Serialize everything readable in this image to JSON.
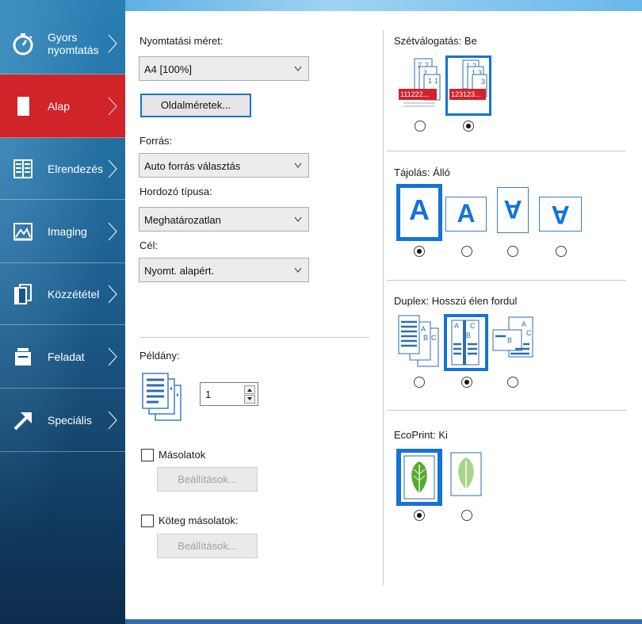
{
  "sidebar": {
    "items": [
      {
        "label_line1": "Gyors",
        "label_line2": "nyomtatás",
        "icon": "stopwatch-icon",
        "active": false
      },
      {
        "label_line1": "Alap",
        "label_line2": "",
        "icon": "page-icon",
        "active": true
      },
      {
        "label_line1": "Elrendezés",
        "label_line2": "",
        "icon": "layout-icon",
        "active": false
      },
      {
        "label_line1": "Imaging",
        "label_line2": "",
        "icon": "image-icon",
        "active": false
      },
      {
        "label_line1": "Közzététel",
        "label_line2": "",
        "icon": "publish-icon",
        "active": false
      },
      {
        "label_line1": "Feladat",
        "label_line2": "",
        "icon": "job-icon",
        "active": false
      },
      {
        "label_line1": "Speciális",
        "label_line2": "",
        "icon": "arrow-icon",
        "active": false
      }
    ],
    "colors": {
      "active": "#d0232a",
      "base": "#1d5f8f"
    }
  },
  "left": {
    "print_size_label": "Nyomtatási méret:",
    "print_size_value": "A4 [100%]",
    "page_sizes_button": "Oldalméretek...",
    "source_label": "Forrás:",
    "source_value": "Auto forrás választás",
    "media_label": "Hordozó típusa:",
    "media_value": "Meghatározatlan",
    "dest_label": "Cél:",
    "dest_value": "Nyomt. alapért.",
    "copies_label": "Példány:",
    "copies_value": "1",
    "copies_checkbox": "Másolatok",
    "copies_settings": "Beállítások...",
    "batch_checkbox": "Köteg másolatok:",
    "batch_settings": "Beállítások..."
  },
  "right": {
    "collate_label": "Szétválogatás:",
    "collate_value": "Be",
    "collate_off_text": "111222...",
    "collate_on_text": "123123...",
    "orientation_label": "Tájolás:",
    "orientation_value": "Álló",
    "orientation_letter": "A",
    "duplex_label": "Duplex:",
    "duplex_value": "Hosszú élen fordul",
    "ecoprint_label": "EcoPrint:",
    "ecoprint_value": "Ki"
  },
  "accent": "#1473d9"
}
